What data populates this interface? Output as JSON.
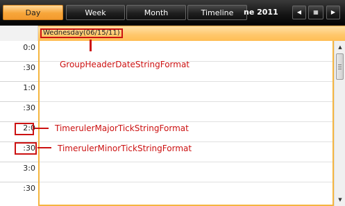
{
  "toolbar": {
    "views": [
      "Day",
      "Week",
      "Month",
      "Timeline"
    ],
    "active_view": "Day",
    "date_title": "ne 2011",
    "prev_icon": "◀",
    "calendar_icon": "▦",
    "next_icon": "▶"
  },
  "group_header": {
    "date": "Wednesday(06/15/11)"
  },
  "timeruler": {
    "ticks": [
      "0:0",
      ":30",
      "1:0",
      ":30",
      "2:0",
      ":30",
      "3:0",
      ":30"
    ]
  },
  "scrollbar": {
    "up_icon": "▲",
    "down_icon": "▼"
  },
  "annotations": {
    "group_header": "GroupHeaderDateStringFormat",
    "major_tick": "TimerulerMajorTickStringFormat",
    "minor_tick": "TimerulerMinorTickStringFormat"
  },
  "colors": {
    "annotation": "#cc1111",
    "accent": "#f5b53f"
  }
}
